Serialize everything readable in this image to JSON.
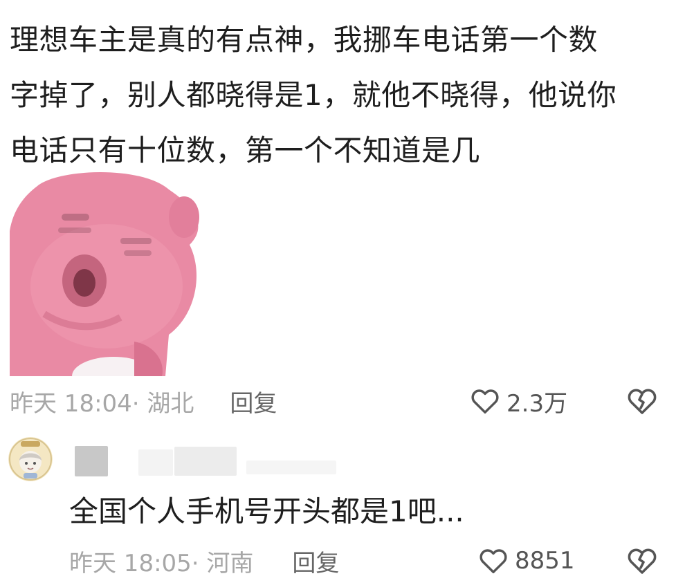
{
  "comment": {
    "text_lines": [
      "理想车主是真的有点神，我挪车电话第一个数",
      "字掉了，别人都晓得是1，就他不晓得，他说你",
      "电话只有十位数，第一个不知道是几"
    ],
    "time_location": "昨天 18:04· 湖北",
    "reply_label": "回复",
    "like_count": "2.3万"
  },
  "reply": {
    "text": "全国个人手机号开头都是1吧...",
    "time_location": "昨天 18:05· 河南",
    "reply_label": "回复",
    "like_count": "8851"
  },
  "colors": {
    "meta_gray": "#a7a7a7",
    "text_dark": "#1e1e1e",
    "sticker_pink": "#e98aa4"
  },
  "icons": {
    "like": "heart-outline-icon",
    "dislike": "broken-heart-icon",
    "sticker": "pink-cartoon-sticker"
  }
}
